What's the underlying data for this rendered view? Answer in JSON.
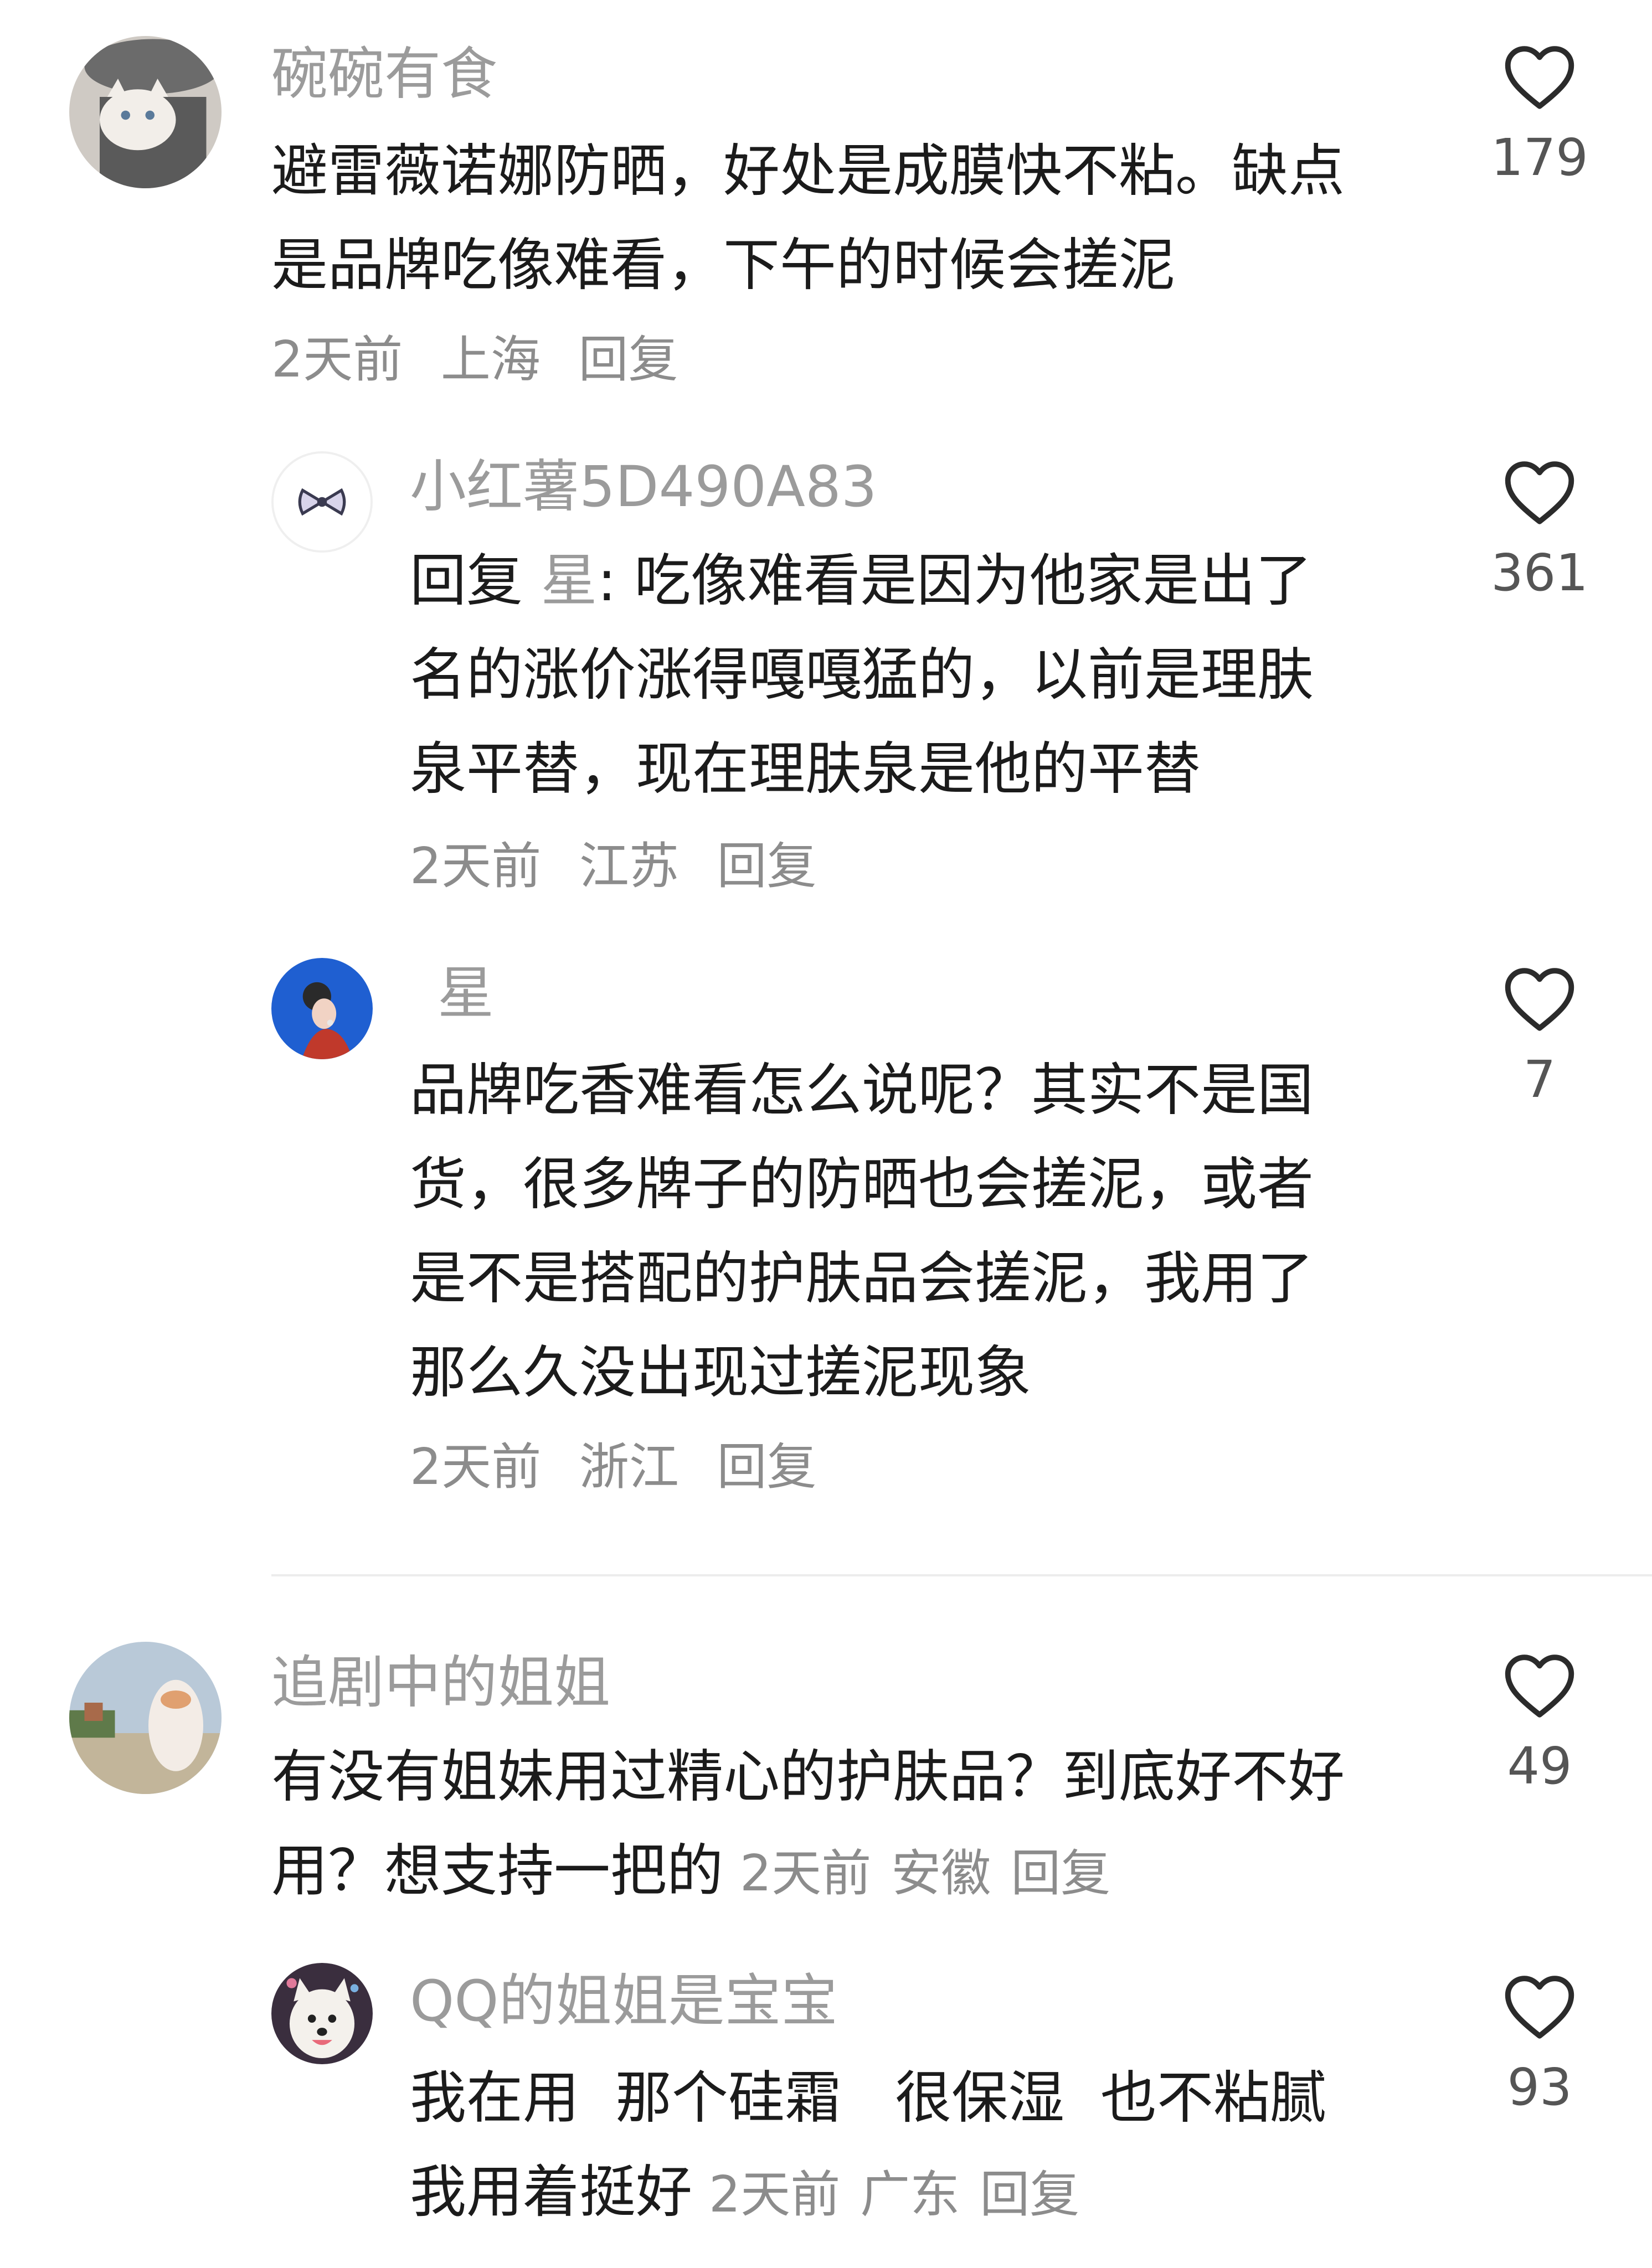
{
  "comments": [
    {
      "username": "碗碗有食",
      "text_lines": [
        "避雷薇诺娜防晒，好处是成膜快不粘。缺点",
        "是品牌吃像难看，下午的时候会搓泥"
      ],
      "time": "2天前",
      "location": "上海",
      "reply_label": "回复",
      "likes": "179",
      "avatar_icon": "cat-avatar-icon"
    },
    {
      "username": "小红薯5D490A83",
      "reply_prefix": "回复",
      "reply_to": "星",
      "text_lines": [
        ": 吃像难看是因为他家是出了",
        "名的涨价涨得嘎嘎猛的，以前是理肤",
        "泉平替，现在理肤泉是他的平替"
      ],
      "time": "2天前",
      "location": "江苏",
      "reply_label": "回复",
      "likes": "361",
      "avatar_icon": "bow-avatar-icon"
    },
    {
      "username": "星",
      "text_lines": [
        "品牌吃香难看怎么说呢？其实不是国",
        "货，很多牌子的防晒也会搓泥，或者",
        "是不是搭配的护肤品会搓泥，我用了",
        "那么久没出现过搓泥现象"
      ],
      "time": "2天前",
      "location": "浙江",
      "reply_label": "回复",
      "likes": "7",
      "avatar_icon": "girl-avatar-icon"
    },
    {
      "username": "追剧中的姐姐",
      "text_lines": [
        "有没有姐妹用过精心的护肤品？到底好不好",
        "用？想支持一把的"
      ],
      "time": "2天前",
      "location": "安徽",
      "reply_label": "回复",
      "likes": "49",
      "avatar_icon": "outdoor-avatar-icon"
    },
    {
      "username": "QQ的姐姐是宝宝",
      "text_lines": [
        "我在用  那个硅霜   很保湿  也不粘腻",
        "我用着挺好"
      ],
      "time": "2天前",
      "location": "广东",
      "reply_label": "回复",
      "likes": "93",
      "avatar_icon": "dog-avatar-icon"
    }
  ],
  "icons": {
    "like": "heart-icon"
  },
  "colors": {
    "username": "#9b9b9b",
    "text": "#1b1b1b",
    "meta": "#8c8c8c",
    "divider": "#ececec"
  }
}
